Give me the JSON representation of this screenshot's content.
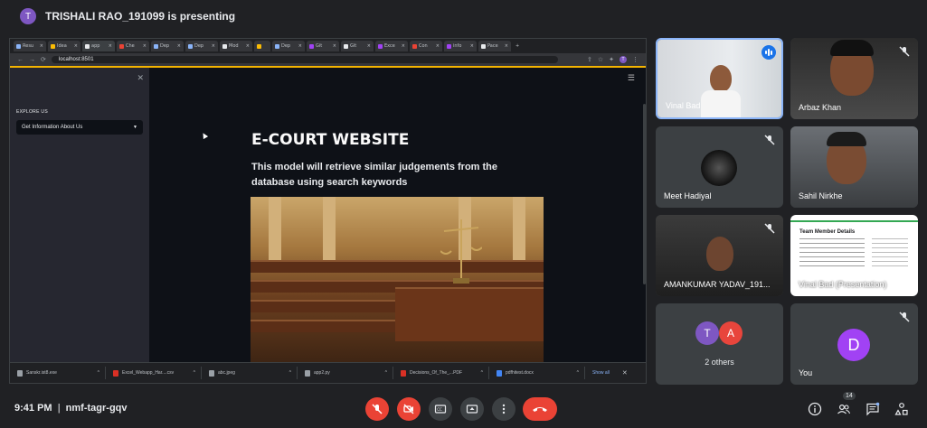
{
  "top": {
    "avatar_letter": "T",
    "presenting_text": "TRISHALI RAO_191099 is presenting"
  },
  "browser": {
    "tabs": [
      "Resu",
      "Idea",
      "app",
      "Che",
      "Dep",
      "Dep",
      "Mod",
      "",
      "Dep",
      "Git",
      "Git",
      "Exce",
      "Con",
      "info",
      "Pace"
    ],
    "url": "localhost:8501",
    "profile_letter": "T"
  },
  "app": {
    "sidebar_section": "EXPLORE US",
    "select_value": "Get Information About Us",
    "title": "E-COURT WEBSITE",
    "subtitle": "This model will retrieve similar judgements from the database using search keywords"
  },
  "downloads": {
    "items": [
      "Sanskr.ist8.exe",
      "Excel_Webapp_Har....csv",
      "abc.jpeg",
      "app2.py",
      "Decisions_Of_The_...PDF",
      "pdfhitest.docx"
    ],
    "show_all": "Show all"
  },
  "participants": [
    {
      "name": "Vinal Bad"
    },
    {
      "name": "Arbaz Khan"
    },
    {
      "name": "Meet Hadiyal"
    },
    {
      "name": "Sahil Nirkhe"
    },
    {
      "name": "AMANKUMAR YADAV_191...",
      "tile_text": ""
    },
    {
      "name": "Vinal Bad (Presentation)",
      "slide_title": "Team Member Details"
    },
    {
      "name": "",
      "others_letters": [
        "T",
        "A"
      ],
      "others_text": "2 others"
    },
    {
      "name": "You",
      "letter": "D"
    }
  ],
  "bottom": {
    "time": "9:41 PM",
    "meeting_code": "nmf-tagr-gqv",
    "people_count": "14"
  },
  "colors": {
    "accent": "#1a73e8",
    "danger": "#ea4335",
    "tile": "#3c4043",
    "bg": "#202124"
  }
}
